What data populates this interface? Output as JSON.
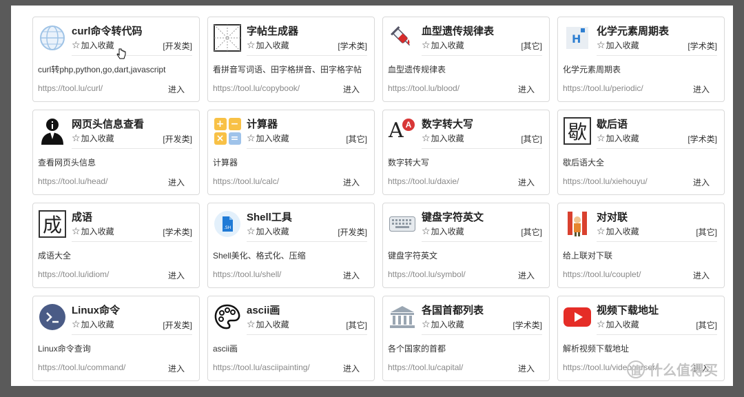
{
  "fav_label": "加入收藏",
  "enter_label": "进入",
  "watermark": {
    "glyph": "值",
    "text": "什么值得买"
  },
  "cards": [
    {
      "title": "curl命令转代码",
      "category": "[开发类]",
      "desc": "curl转php,python,go,dart,javascript",
      "url": "https://tool.lu/curl/",
      "icon": "curl-globe-icon"
    },
    {
      "title": "字帖生成器",
      "category": "[学术类]",
      "desc": "看拼音写词语、田字格拼音、田字格字帖",
      "url": "https://tool.lu/copybook/",
      "icon": "copybook-grid-icon"
    },
    {
      "title": "血型遗传规律表",
      "category": "[其它]",
      "desc": "血型遗传规律表",
      "url": "https://tool.lu/blood/",
      "icon": "syringe-icon"
    },
    {
      "title": "化学元素周期表",
      "category": "[学术类]",
      "desc": "化学元素周期表",
      "url": "https://tool.lu/periodic/",
      "icon": "periodic-table-icon"
    },
    {
      "title": "网页头信息查看",
      "category": "[开发类]",
      "desc": "查看网页头信息",
      "url": "https://tool.lu/head/",
      "icon": "person-info-icon"
    },
    {
      "title": "计算器",
      "category": "[其它]",
      "desc": "计算器",
      "url": "https://tool.lu/calc/",
      "icon": "calculator-icon"
    },
    {
      "title": "数字转大写",
      "category": "[其它]",
      "desc": "数字转大写",
      "url": "https://tool.lu/daxie/",
      "icon": "letter-a-icon"
    },
    {
      "title": "歇后语",
      "category": "[学术类]",
      "desc": "歇后语大全",
      "url": "https://tool.lu/xiehouyu/",
      "icon": "xie-character-icon"
    },
    {
      "title": "成语",
      "category": "[学术类]",
      "desc": "成语大全",
      "url": "https://tool.lu/idiom/",
      "icon": "cheng-character-icon"
    },
    {
      "title": "Shell工具",
      "category": "[开发类]",
      "desc": "Shell美化、格式化、压缩",
      "url": "https://tool.lu/shell/",
      "icon": "shell-file-icon"
    },
    {
      "title": "键盘字符英文",
      "category": "[其它]",
      "desc": "键盘字符英文",
      "url": "https://tool.lu/symbol/",
      "icon": "keyboard-icon"
    },
    {
      "title": "对对联",
      "category": "[其它]",
      "desc": "给上联对下联",
      "url": "https://tool.lu/couplet/",
      "icon": "couplet-icon"
    },
    {
      "title": "Linux命令",
      "category": "[开发类]",
      "desc": "Linux命令查询",
      "url": "https://tool.lu/command/",
      "icon": "terminal-icon"
    },
    {
      "title": "ascii画",
      "category": "[其它]",
      "desc": "ascii画",
      "url": "https://tool.lu/asciipainting/",
      "icon": "palette-icon"
    },
    {
      "title": "各国首都列表",
      "category": "[学术类]",
      "desc": "各个国家的首都",
      "url": "https://tool.lu/capital/",
      "icon": "capitol-building-icon"
    },
    {
      "title": "视频下载地址",
      "category": "[其它]",
      "desc": "解析视频下载地址",
      "url": "https://tool.lu/videoparser/",
      "icon": "youtube-play-icon"
    }
  ],
  "icon_glyphs": {
    "xie": "歇",
    "cheng": "成",
    "letter_a": "A",
    "letter_a_badge": "A",
    "periodic": "H",
    "shell": ".SH"
  }
}
